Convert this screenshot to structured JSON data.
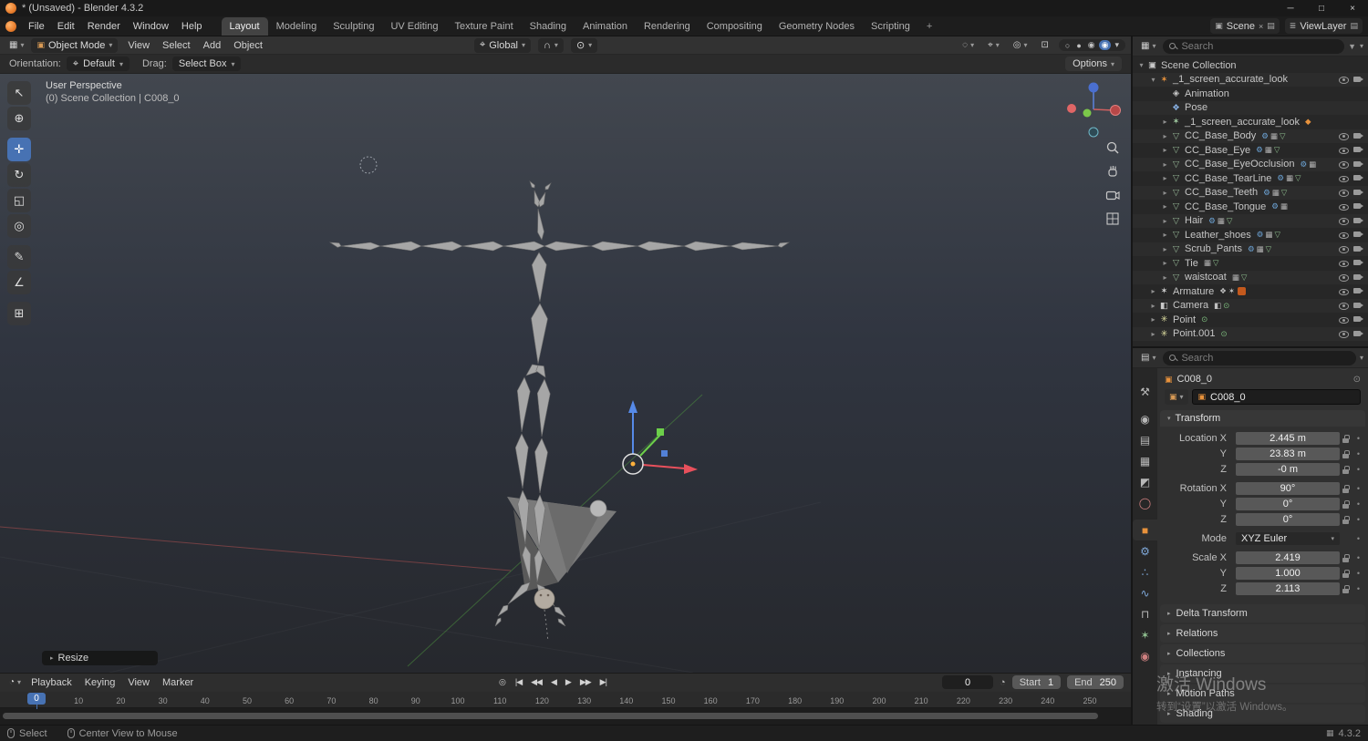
{
  "window": {
    "title": "* (Unsaved) - Blender 4.3.2"
  },
  "colors": {
    "accent": "#4772b3",
    "object_orange": "#e8923c",
    "axis_x": "#e8505c",
    "axis_y": "#6ccf4a",
    "axis_z": "#568ae8"
  },
  "icons": {
    "caret_down": "▾",
    "caret_right": "▸",
    "editor_grid": "▦",
    "close": "×",
    "minimize": "─",
    "maximize": "□",
    "magnet": "∩",
    "orientation": "⌖",
    "proportional": "⊙",
    "visibility": "◌",
    "gizmos": "⌖",
    "overlays": "◎",
    "xray": "⊡",
    "shade_wire": "○",
    "shade_solid": "●",
    "shade_material": "◉",
    "shade_rendered": "◉",
    "scene": "▣",
    "viewlayer": "≣",
    "duplicate": "▤",
    "unlink": "×",
    "clock": "◔",
    "autokey": "◎",
    "pin": "⊙",
    "object_mode": "▣",
    "funnel": "▼",
    "network": "▦"
  },
  "menubar": {
    "menus": [
      "File",
      "Edit",
      "Render",
      "Window",
      "Help"
    ],
    "workspaces": [
      "Layout",
      "Modeling",
      "Sculpting",
      "UV Editing",
      "Texture Paint",
      "Shading",
      "Animation",
      "Rendering",
      "Compositing",
      "Geometry Nodes",
      "Scripting"
    ],
    "active_workspace": "Layout",
    "add_workspace": "+",
    "scene_label": "Scene",
    "viewlayer_label": "ViewLayer"
  },
  "viewport_header": {
    "mode": "Object Mode",
    "menus": [
      "View",
      "Select",
      "Add",
      "Object"
    ],
    "orientation": "Global"
  },
  "tool_settings": {
    "orientation_label": "Orientation:",
    "orientation_value": "Default",
    "drag_label": "Drag:",
    "drag_value": "Select Box",
    "options_label": "Options"
  },
  "toolbar": {
    "tools": [
      {
        "id": "select-box",
        "glyph": "↖",
        "active": false
      },
      {
        "id": "cursor",
        "glyph": "⊕",
        "active": false
      },
      {
        "id": "move",
        "glyph": "✛",
        "active": true,
        "gap": true
      },
      {
        "id": "rotate",
        "glyph": "↻",
        "active": false
      },
      {
        "id": "scale",
        "glyph": "◱",
        "active": false
      },
      {
        "id": "transform",
        "glyph": "◎",
        "active": false
      },
      {
        "id": "annotate",
        "glyph": "✎",
        "active": false,
        "gap": true
      },
      {
        "id": "measure",
        "glyph": "∠",
        "active": false
      },
      {
        "id": "add-cube",
        "glyph": "⊞",
        "active": false,
        "gap": true
      }
    ]
  },
  "viewport": {
    "persp_label": "User Perspective",
    "collection_label": "(0) Scene Collection | C008_0",
    "resize_label": "Resize"
  },
  "outliner": {
    "search_placeholder": "Search",
    "icon_glyphs": {
      "collection": "▣",
      "character": "✶",
      "anim": "◈",
      "pose": "❖",
      "armature": "✶",
      "armature_obj": "✶",
      "mesh": "▽",
      "camera": "◧",
      "light": "✳"
    },
    "trail_glyphs": {
      "wrench": "⚙",
      "grid": "▦",
      "tri": "▽",
      "badge": "◆",
      "pose-mini": "❖",
      "armature-mini": "✶",
      "cam-mini": "◧",
      "link": "⊙"
    },
    "items": [
      {
        "name": "Scene Collection",
        "depth": 0,
        "icon": "collection",
        "arrow": "open",
        "right": false
      },
      {
        "name": "_1_screen_accurate_look",
        "depth": 1,
        "icon": "character",
        "arrow": "open",
        "right": true
      },
      {
        "name": "Animation",
        "depth": 2,
        "icon": "anim",
        "arrow": null,
        "right": false
      },
      {
        "name": "Pose",
        "depth": 2,
        "icon": "pose",
        "arrow": null,
        "right": false
      },
      {
        "name": "_1_screen_accurate_look",
        "depth": 2,
        "icon": "armature",
        "arrow": "closed",
        "trail": [
          "badge"
        ],
        "right": false
      },
      {
        "name": "CC_Base_Body",
        "depth": 2,
        "icon": "mesh",
        "arrow": "closed",
        "trail": [
          "wrench",
          "grid",
          "tri"
        ],
        "right": true
      },
      {
        "name": "CC_Base_Eye",
        "depth": 2,
        "icon": "mesh",
        "arrow": "closed",
        "trail": [
          "wrench",
          "grid",
          "tri"
        ],
        "right": true
      },
      {
        "name": "CC_Base_EyeOcclusion",
        "depth": 2,
        "icon": "mesh",
        "arrow": "closed",
        "trail": [
          "wrench",
          "grid"
        ],
        "right": true
      },
      {
        "name": "CC_Base_TearLine",
        "depth": 2,
        "icon": "mesh",
        "arrow": "closed",
        "trail": [
          "wrench",
          "grid",
          "tri"
        ],
        "right": true
      },
      {
        "name": "CC_Base_Teeth",
        "depth": 2,
        "icon": "mesh",
        "arrow": "closed",
        "trail": [
          "wrench",
          "grid",
          "tri"
        ],
        "right": true
      },
      {
        "name": "CC_Base_Tongue",
        "depth": 2,
        "icon": "mesh",
        "arrow": "closed",
        "trail": [
          "wrench",
          "grid"
        ],
        "right": true
      },
      {
        "name": "Hair",
        "depth": 2,
        "icon": "mesh",
        "arrow": "closed",
        "trail": [
          "wrench",
          "grid",
          "tri"
        ],
        "right": true
      },
      {
        "name": "Leather_shoes",
        "depth": 2,
        "icon": "mesh",
        "arrow": "closed",
        "trail": [
          "wrench",
          "grid",
          "tri"
        ],
        "right": true
      },
      {
        "name": "Scrub_Pants",
        "depth": 2,
        "icon": "mesh",
        "arrow": "closed",
        "trail": [
          "wrench",
          "grid",
          "tri"
        ],
        "right": true
      },
      {
        "name": "Tie",
        "depth": 2,
        "icon": "mesh",
        "arrow": "closed",
        "trail": [
          "grid",
          "tri"
        ],
        "right": true
      },
      {
        "name": "waistcoat",
        "depth": 2,
        "icon": "mesh",
        "arrow": "closed",
        "trail": [
          "grid",
          "tri"
        ],
        "right": true
      },
      {
        "name": "Armature",
        "depth": 1,
        "icon": "armature_obj",
        "arrow": "closed",
        "trail": [
          "pose-mini",
          "armature-mini",
          "orange-box"
        ],
        "right": true
      },
      {
        "name": "Camera",
        "depth": 1,
        "icon": "camera",
        "arrow": "closed",
        "trail": [
          "cam-mini",
          "link"
        ],
        "right": true
      },
      {
        "name": "Point",
        "depth": 1,
        "icon": "light",
        "arrow": "closed",
        "trail": [
          "link"
        ],
        "right": true
      },
      {
        "name": "Point.001",
        "depth": 1,
        "icon": "light",
        "arrow": "closed",
        "trail": [
          "link"
        ],
        "right": true
      }
    ]
  },
  "properties": {
    "search_placeholder": "Search",
    "breadcrumb": "C008_0",
    "object_name": "C008_0",
    "tabs": [
      {
        "id": "tool",
        "glyph": "⚒",
        "color": "#b8b8b8",
        "active": false
      },
      {
        "id": "render",
        "glyph": "◉",
        "color": "#b8b8b8",
        "active": false,
        "gap": true
      },
      {
        "id": "output",
        "glyph": "▤",
        "color": "#b8b8b8",
        "active": false
      },
      {
        "id": "view-layer",
        "glyph": "▦",
        "color": "#b8b8b8",
        "active": false
      },
      {
        "id": "scene",
        "glyph": "◩",
        "color": "#b8b8b8",
        "active": false
      },
      {
        "id": "world",
        "glyph": "◯",
        "color": "#d08080",
        "active": false
      },
      {
        "id": "object",
        "glyph": "■",
        "color": "#e8923c",
        "active": true,
        "gap": true
      },
      {
        "id": "modifiers",
        "glyph": "⚙",
        "color": "#7fa8d8",
        "active": false
      },
      {
        "id": "particles",
        "glyph": "∴",
        "color": "#7fa8d8",
        "active": false
      },
      {
        "id": "physics",
        "glyph": "∿",
        "color": "#7fa8d8",
        "active": false
      },
      {
        "id": "constraints",
        "glyph": "⊓",
        "color": "#b8b8b8",
        "active": false
      },
      {
        "id": "data",
        "glyph": "✶",
        "color": "#8fbf8f",
        "active": false
      },
      {
        "id": "material",
        "glyph": "◉",
        "color": "#cf8080",
        "active": false
      }
    ],
    "transform": {
      "title": "Transform",
      "groups": [
        {
          "rows": [
            {
              "label": "Location X",
              "value": "2.445 m"
            },
            {
              "label": "Y",
              "value": "23.83 m"
            },
            {
              "label": "Z",
              "value": "-0 m"
            }
          ]
        },
        {
          "rows": [
            {
              "label": "Rotation X",
              "value": "90°"
            },
            {
              "label": "Y",
              "value": "0°"
            },
            {
              "label": "Z",
              "value": "0°"
            }
          ]
        },
        {
          "rows": [
            {
              "label": "Mode",
              "value": "XYZ Euler",
              "dropdown": true
            }
          ]
        },
        {
          "rows": [
            {
              "label": "Scale X",
              "value": "2.419"
            },
            {
              "label": "Y",
              "value": "1.000"
            },
            {
              "label": "Z",
              "value": "2.113"
            }
          ]
        }
      ]
    },
    "collapsed_panels": [
      "Delta Transform",
      "Relations",
      "Collections",
      "Instancing",
      "Motion Paths",
      "Shading"
    ]
  },
  "timeline": {
    "menus": [
      "Playback",
      "Keying",
      "View",
      "Marker"
    ],
    "playback_buttons": [
      {
        "id": "jump-to-start",
        "glyph": "|◀"
      },
      {
        "id": "prev-keyframe",
        "glyph": "◀◀"
      },
      {
        "id": "play-reverse",
        "glyph": "◀"
      },
      {
        "id": "play",
        "glyph": "▶"
      },
      {
        "id": "next-keyframe",
        "glyph": "▶▶"
      },
      {
        "id": "jump-to-end",
        "glyph": "▶|"
      }
    ],
    "current_frame": "0",
    "start_label": "Start",
    "start_value": "1",
    "end_label": "End",
    "end_value": "250",
    "ticks": [
      "0",
      "10",
      "20",
      "30",
      "40",
      "50",
      "60",
      "70",
      "80",
      "90",
      "100",
      "110",
      "120",
      "130",
      "140",
      "150",
      "160",
      "170",
      "180",
      "190",
      "200",
      "210",
      "220",
      "230",
      "240",
      "250"
    ]
  },
  "statusbar": {
    "select_label": "Select",
    "center_label": "Center View to Mouse",
    "version": "4.3.2"
  },
  "watermark": {
    "line1": "激活 Windows",
    "line2": "转到“设置”以激活 Windows。"
  }
}
